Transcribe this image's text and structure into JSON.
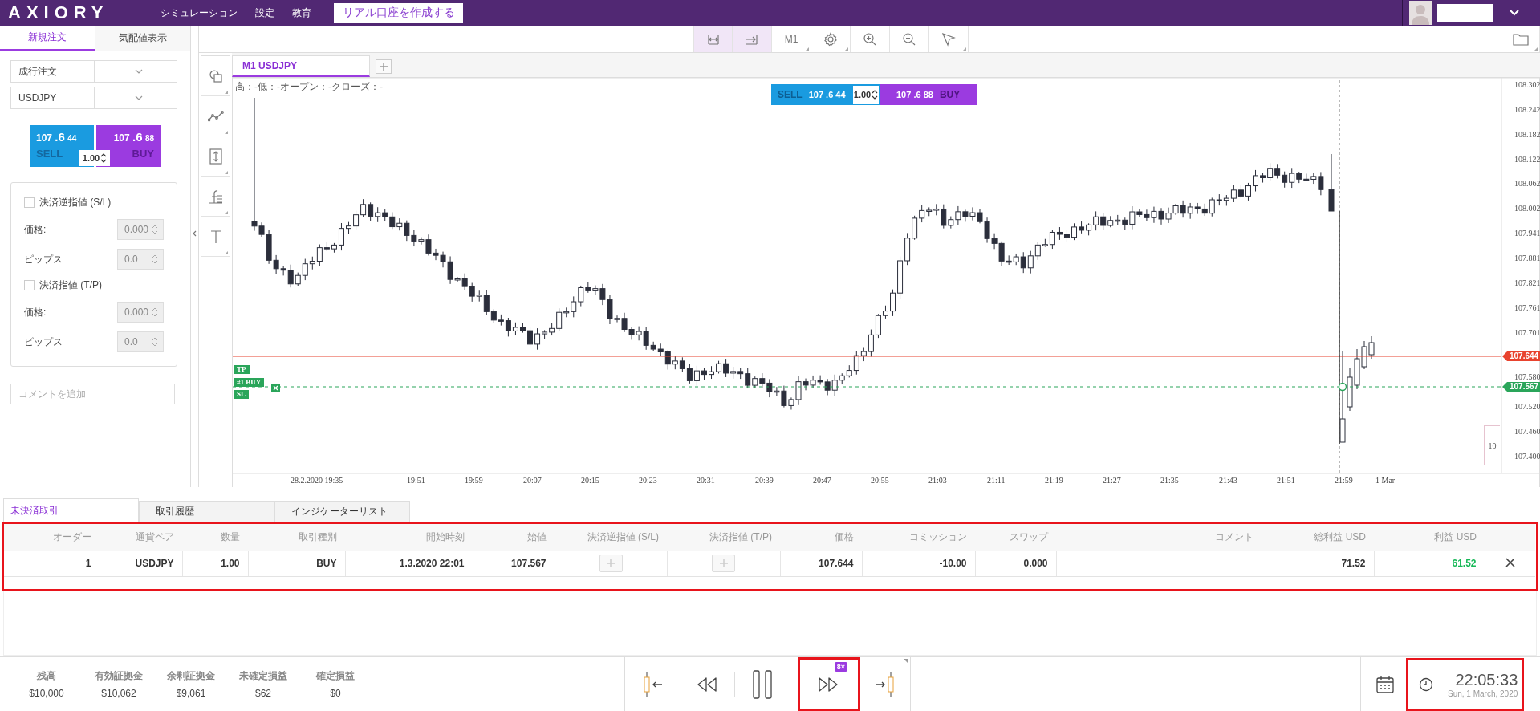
{
  "header": {
    "logo": "AXIORY",
    "menu": [
      {
        "label": "シミュレーション"
      },
      {
        "label": "設定"
      },
      {
        "label": "教育"
      }
    ],
    "cta": "リアル口座を作成する"
  },
  "order_panel": {
    "tabs": [
      {
        "label": "新規注文",
        "selected": true
      },
      {
        "label": "気配値表示",
        "selected": false
      }
    ],
    "order_type": "成行注文",
    "symbol": "USDJPY",
    "sell": {
      "label": "SELL",
      "price": "107",
      "pips": ".6",
      "fraction": "44"
    },
    "buy": {
      "label": "BUY",
      "price": "107",
      "pips": ".6",
      "fraction": "88"
    },
    "lots": "1.00",
    "stops": [
      {
        "label": "決済逆指値 (S/L)",
        "checked": false,
        "price_label": "価格:",
        "price": "0.000",
        "pips_label": "ピップス",
        "pips": "0.0"
      },
      {
        "label": "決済指値 (T/P)",
        "checked": false,
        "price_label": "価格:",
        "price": "0.000",
        "pips_label": "ピップス",
        "pips": "0.0"
      }
    ],
    "comment": {
      "placeholder": "コメントを追加"
    }
  },
  "toolbar": {
    "timeframe": "M1"
  },
  "chart": {
    "tab": "M1 USDJPY",
    "ohlc": "高：-低：-オープン：-クローズ：-",
    "widget": {
      "sell": {
        "label": "SELL",
        "price": "107",
        "pips": ".6",
        "fraction": "44"
      },
      "lots": "1.00",
      "buy": {
        "label": "BUY",
        "price": "107",
        "pips": ".6",
        "fraction": "88"
      }
    },
    "price_ticks": [
      "108.302",
      "108.242",
      "108.182",
      "108.122",
      "108.062",
      "108.002",
      "107.941",
      "107.881",
      "107.821",
      "107.761",
      "107.701",
      "107.580",
      "107.520",
      "107.460",
      "107.400"
    ],
    "price_tags": [
      {
        "text": "107.644",
        "kind": "current"
      },
      {
        "text": "107.567",
        "kind": "position"
      }
    ],
    "position_tags": [
      {
        "text": "TP",
        "kind": "tp"
      },
      {
        "text": "#1 BUY",
        "kind": "entry"
      },
      {
        "text": "SL",
        "kind": "sl"
      }
    ],
    "volume_scale": "10",
    "time_ticks": [
      "28.2.2020 19:35",
      "19:51",
      "19:59",
      "20:07",
      "20:15",
      "20:23",
      "20:31",
      "20:39",
      "20:47",
      "20:55",
      "21:03",
      "21:11",
      "21:19",
      "21:27",
      "21:35",
      "21:43",
      "21:51",
      "21:59",
      "1 Mar"
    ]
  },
  "positions": {
    "tabs": [
      {
        "label": "未決済取引",
        "selected": true
      },
      {
        "label": "取引履歴",
        "selected": false
      },
      {
        "label": "インジケーターリスト",
        "selected": false
      }
    ],
    "highlighted": true,
    "columns": [
      "オーダー",
      "通貨ペア",
      "数量",
      "取引種別",
      "開始時刻",
      "始値",
      "決済逆指値 (S/L)",
      "決済指値 (T/P)",
      "価格",
      "コミッション",
      "スワップ",
      "コメント",
      "総利益 USD",
      "利益 USD"
    ],
    "rows": [
      {
        "cells": [
          {
            "kind": "text",
            "text": "1"
          },
          {
            "kind": "text",
            "text": "USDJPY"
          },
          {
            "kind": "text",
            "text": "1.00"
          },
          {
            "kind": "text",
            "text": "BUY"
          },
          {
            "kind": "text",
            "text": "1.3.2020 22:01"
          },
          {
            "kind": "text",
            "text": "107.567"
          },
          {
            "kind": "add"
          },
          {
            "kind": "add"
          },
          {
            "kind": "text",
            "text": "107.644"
          },
          {
            "kind": "text",
            "text": "-10.00"
          },
          {
            "kind": "text",
            "text": "0.000"
          },
          {
            "kind": "empty"
          },
          {
            "kind": "text",
            "text": "71.52"
          },
          {
            "kind": "profit",
            "text": "61.52"
          }
        ]
      }
    ]
  },
  "footer": {
    "stats": [
      {
        "label": "残高",
        "value": "$10,000"
      },
      {
        "label": "有効証拠金",
        "value": "$10,062"
      },
      {
        "label": "余剰証拠金",
        "value": "$9,061"
      },
      {
        "label": "未確定損益",
        "value": "$62"
      },
      {
        "label": "確定損益",
        "value": "$0"
      }
    ],
    "fast_forward": {
      "speed": "8×",
      "highlighted": true
    },
    "clock": {
      "time": "22:05:33",
      "date": "Sun, 1 March, 2020",
      "highlighted": true
    }
  }
}
